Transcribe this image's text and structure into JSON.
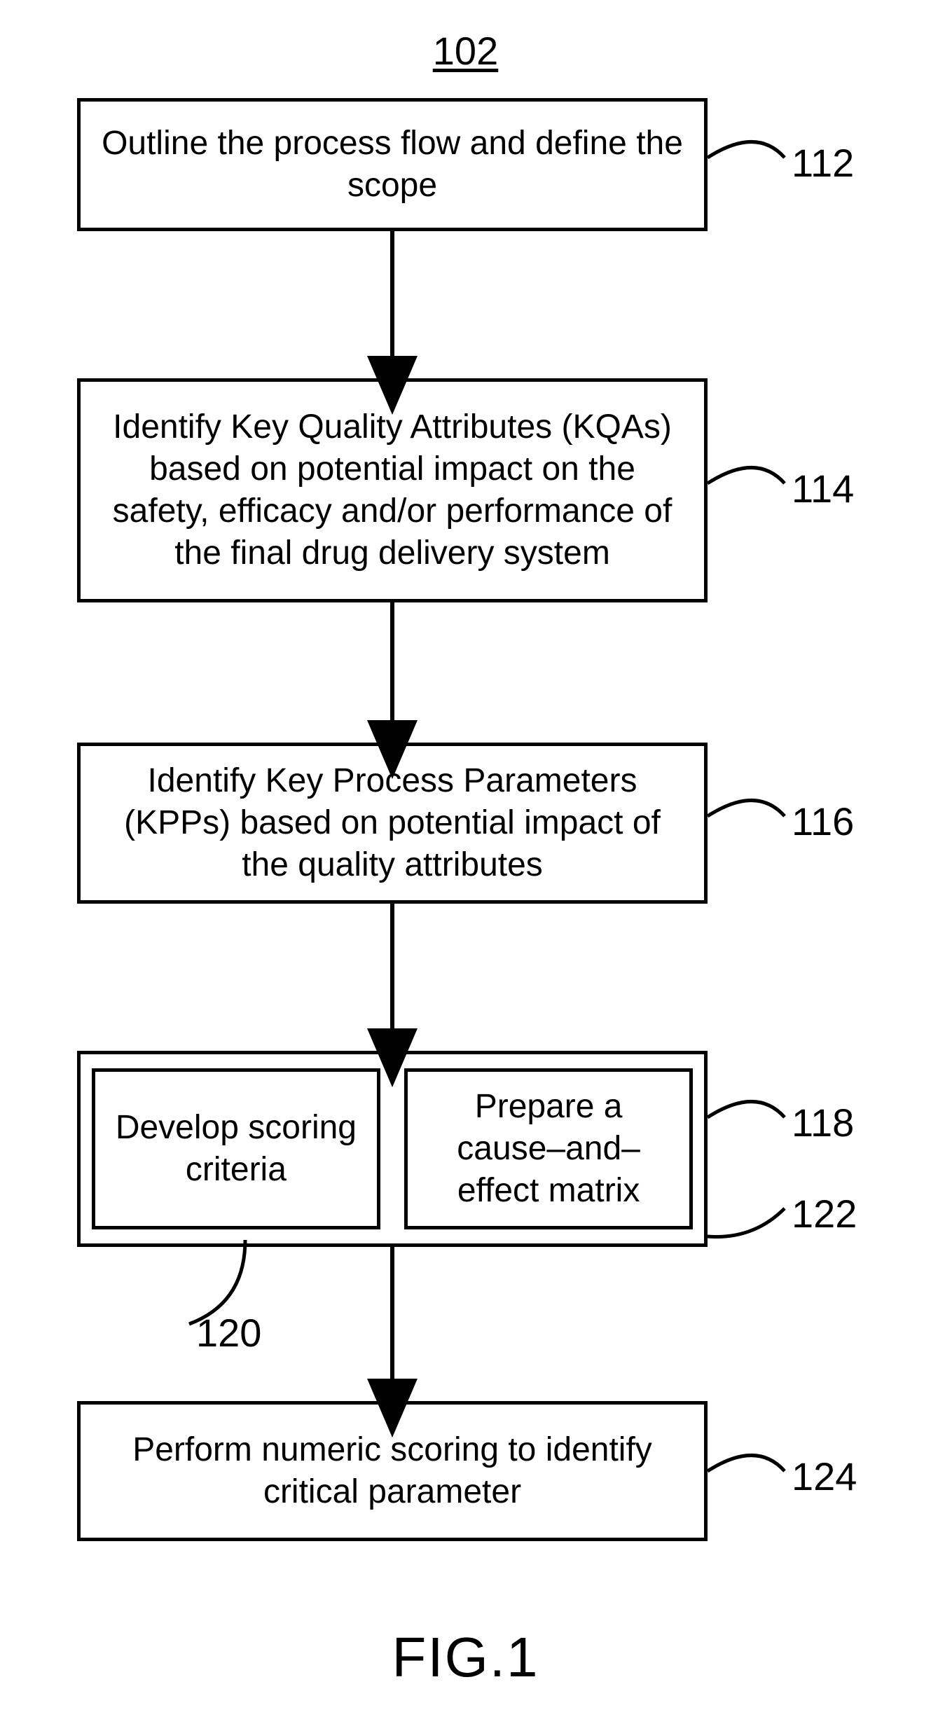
{
  "title": "102",
  "boxes": {
    "b112": "Outline the process flow and define the scope",
    "b114": "Identify Key Quality Attributes (KQAs) based on potential impact on the safety, efficacy and/or performance of the final drug delivery system",
    "b116": "Identify Key Process Parameters (KPPs) based on potential impact of the quality attributes",
    "b120": "Develop scoring criteria",
    "b122": "Prepare a cause–and–effect matrix",
    "b124": "Perform numeric scoring to identify critical parameter"
  },
  "labels": {
    "l112": "112",
    "l114": "114",
    "l116": "116",
    "l118": "118",
    "l120": "120",
    "l122": "122",
    "l124": "124"
  },
  "figure": "FIG.1"
}
